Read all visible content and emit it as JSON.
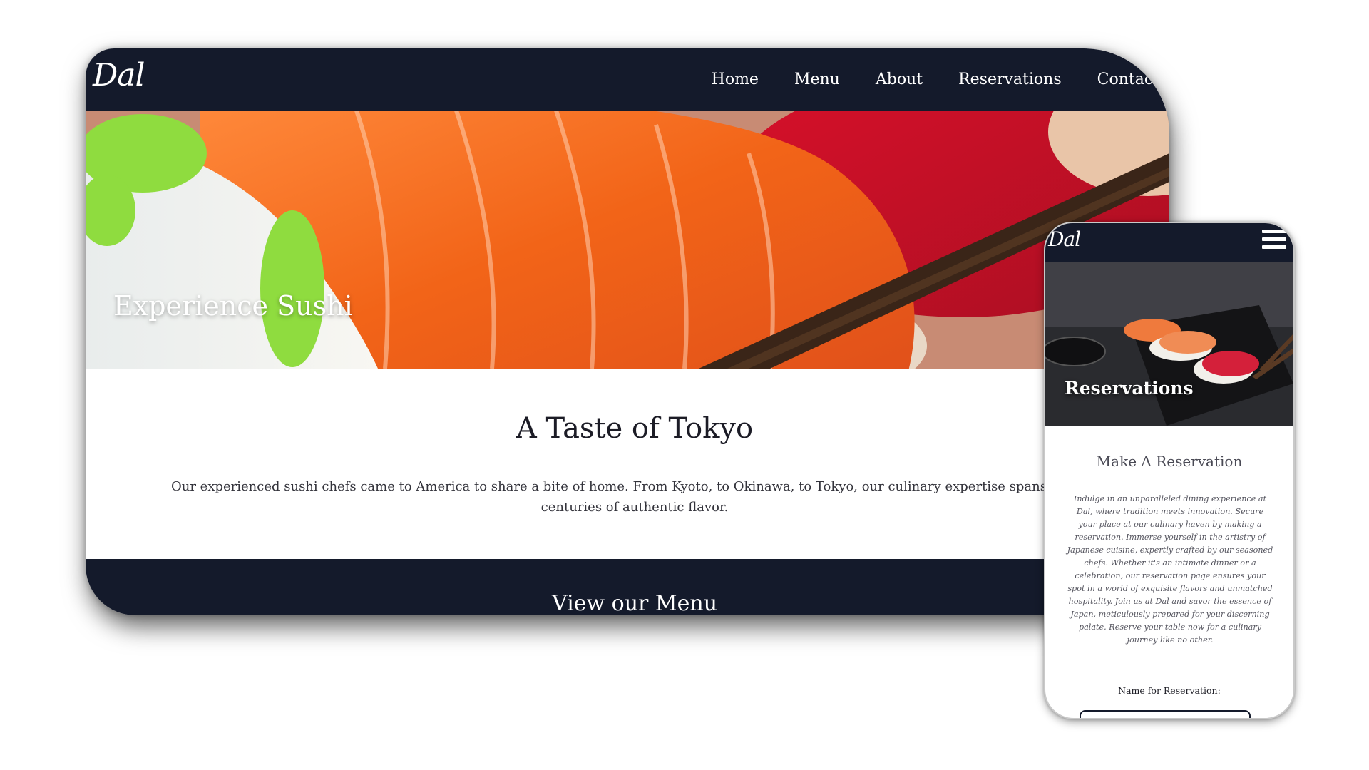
{
  "colors": {
    "nav_bg": "#141a2b",
    "text_dark": "#1c1c26",
    "text_light": "#ffffff"
  },
  "desktop": {
    "logo": "Dal",
    "nav": [
      "Home",
      "Menu",
      "About",
      "Reservations",
      "Contact"
    ],
    "hero_title": "Experience Sushi",
    "heading": "A Taste of Tokyo",
    "para_line1": "Our experienced sushi chefs came to America to share a bite of home. From Kyoto, to Okinawa, to Tokyo, our culinary expertise spans generations of tradit",
    "para_line2": "centuries of authentic flavor.",
    "footer_title": "View our Menu"
  },
  "phone": {
    "logo": "Dal",
    "menu_icon": "hamburger-menu-icon",
    "hero_title": "Reservations",
    "heading": "Make A Reservation",
    "para": "Indulge in an unparalleled dining experience at Dal, where tradition meets innovation. Secure your place at our culinary haven by making a reservation. Immerse yourself in the artistry of Japanese cuisine, expertly crafted by our seasoned chefs. Whether it's an intimate dinner or a celebration, our reservation page ensures your spot in a world of exquisite flavors and unmatched hospitality. Join us at Dal and savor the essence of Japan, meticulously prepared for your discerning palate. Reserve your table now for a culinary journey like no other.",
    "name_label": "Name for Reservation:"
  }
}
